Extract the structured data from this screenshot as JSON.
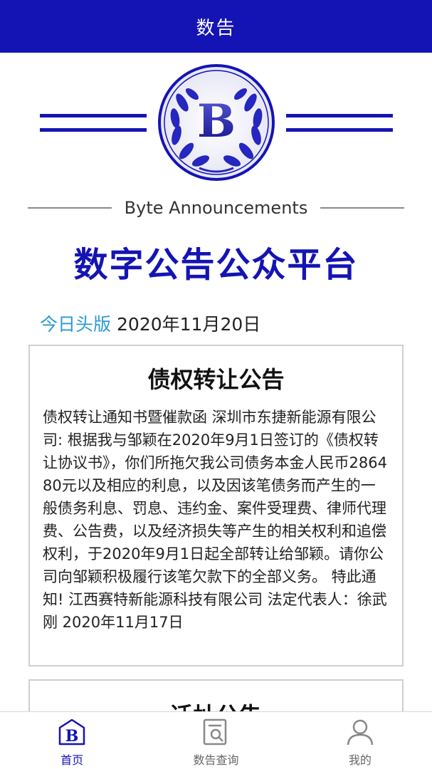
{
  "header": {
    "title": "数告"
  },
  "logo": {
    "letter": "B"
  },
  "subtitle": "Byte Announcements",
  "main_title": "数字公告公众平台",
  "today": {
    "label": "今日头版",
    "date": "2020年11月20日"
  },
  "announcements": [
    {
      "title": "债权转让公告",
      "body": "债权转让通知书暨催款函 深圳市东捷新能源有限公司: 根据我与邹颖在2020年9月1日签订的《债权转让协议书》，你们所拖欠我公司债务本金人民币286480元以及相应的利息，以及因该笔债务而产生的一般债务利息、罚息、违约金、案件受理费、律师代理费、公告费，以及经济损失等产生的相关权利和追偿权利，于2020年9月1日起全部转让给邹颖。请你公司向邹颖积极履行该笔欠款下的全部义务。 特此通知! 江西赛特新能源科技有限公司 法定代表人：徐武刚 2020年11月17日"
    },
    {
      "title": "迁址公告"
    }
  ],
  "tabbar": {
    "home": "首页",
    "search": "数告查询",
    "mine": "我的"
  },
  "colors": {
    "brand": "#1414b4",
    "accent": "#2a9ad6"
  }
}
